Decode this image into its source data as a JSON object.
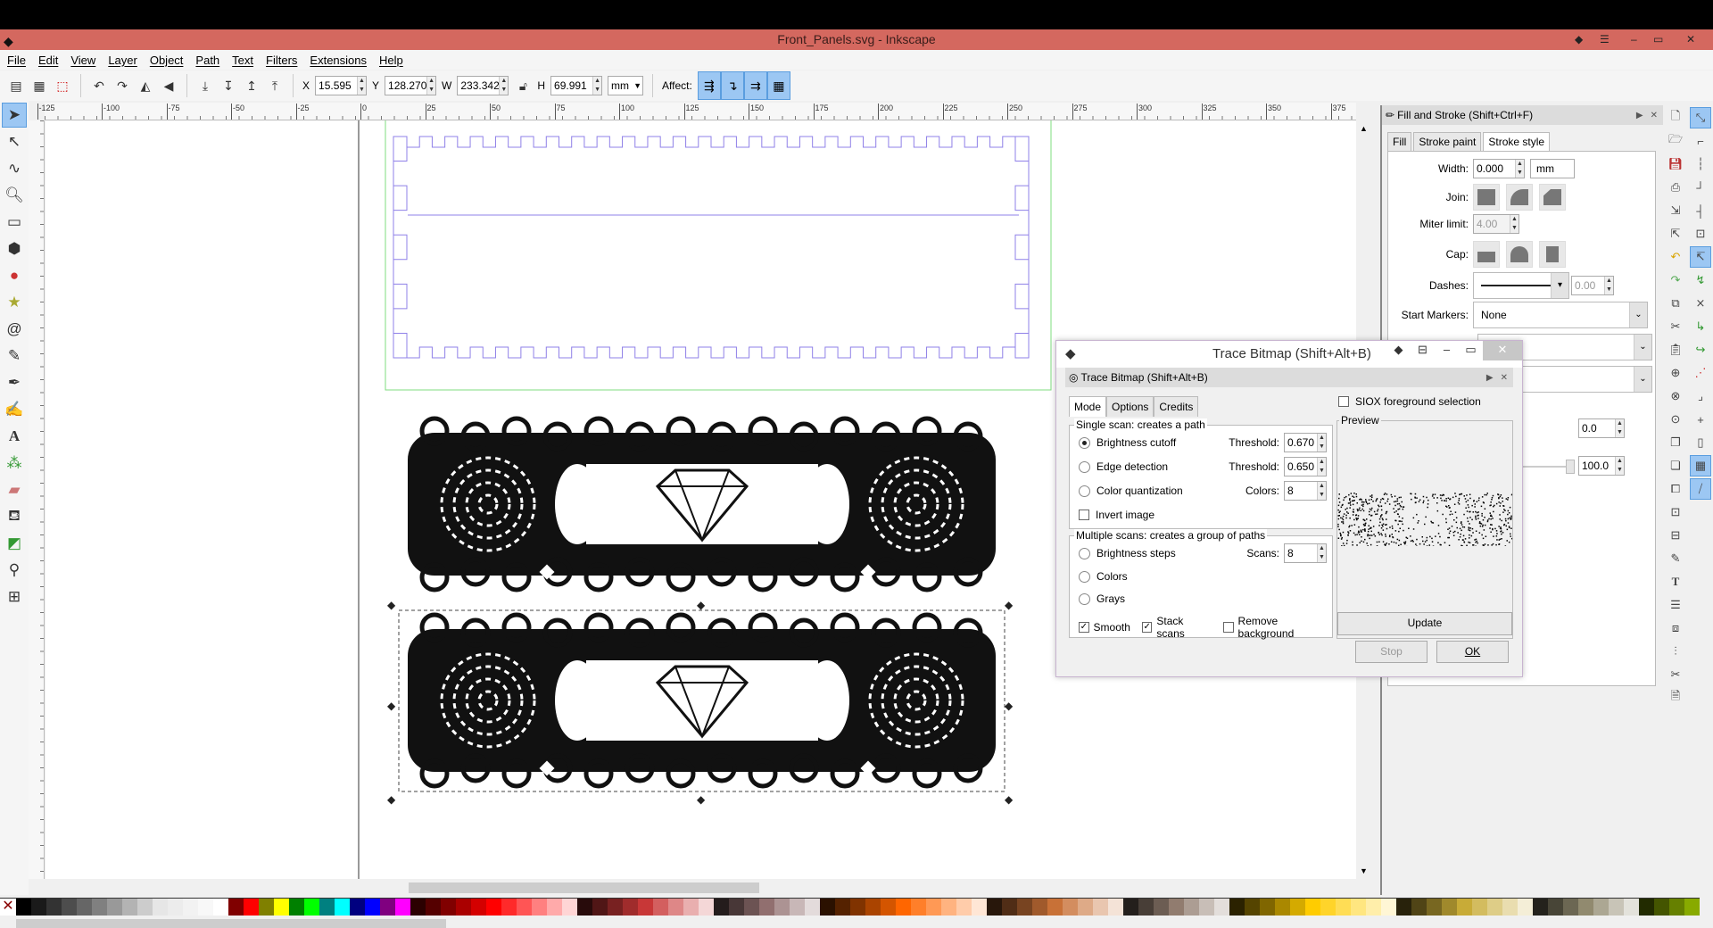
{
  "window": {
    "title": "Front_Panels.svg - Inkscape",
    "min": "–",
    "max": "▭",
    "close": "✕"
  },
  "menu": [
    "File",
    "Edit",
    "View",
    "Layer",
    "Object",
    "Path",
    "Text",
    "Filters",
    "Extensions",
    "Help"
  ],
  "toolbar": {
    "x_label": "X",
    "x": "15.595",
    "y_label": "Y",
    "y": "128.270",
    "w_label": "W",
    "w": "233.342",
    "h_label": "H",
    "h": "69.991",
    "unit": "mm",
    "affect_label": "Affect:"
  },
  "ruler_labels": [
    "-125",
    "-100",
    "-75",
    "-50",
    "-25",
    "0",
    "25",
    "50",
    "75",
    "100",
    "125",
    "150",
    "175",
    "200",
    "225",
    "250",
    "275",
    "300",
    "325",
    "350",
    "375"
  ],
  "tools": [
    "selector-tool",
    "node-tool",
    "tweak-tool",
    "zoom-tool",
    "rectangle-tool",
    "3d-box-tool",
    "ellipse-tool",
    "star-tool",
    "spiral-tool",
    "pencil-tool",
    "pen-tool",
    "calligraphy-tool",
    "text-tool",
    "spray-tool",
    "eraser-tool",
    "paint-bucket-tool",
    "gradient-tool",
    "dropper-tool",
    "connector-tool"
  ],
  "fill_stroke": {
    "title": "Fill and Stroke (Shift+Ctrl+F)",
    "tabs": [
      "Fill",
      "Stroke paint",
      "Stroke style"
    ],
    "width_label": "Width:",
    "width": "0.000",
    "unit": "mm",
    "join_label": "Join:",
    "miter_label": "Miter limit:",
    "miter": "4.00",
    "cap_label": "Cap:",
    "dashes_label": "Dashes:",
    "dash_offset": "0.00",
    "start_markers_label": "Start Markers:",
    "start_markers": "None",
    "blur": "0.0",
    "opacity": "100.0"
  },
  "trace": {
    "window_title": "Trace Bitmap (Shift+Alt+B)",
    "panel_title": "Trace Bitmap (Shift+Alt+B)",
    "tabs": [
      "Mode",
      "Options",
      "Credits"
    ],
    "single_scan_label": "Single scan: creates a path",
    "brightness_cutoff": "Brightness cutoff",
    "threshold_label": "Threshold:",
    "brightness_threshold": "0.670",
    "edge_detection": "Edge detection",
    "edge_threshold": "0.650",
    "color_quantization": "Color quantization",
    "colors_label": "Colors:",
    "colors": "8",
    "invert_image": "Invert image",
    "multiple_scans_label": "Multiple scans: creates a group of paths",
    "brightness_steps": "Brightness steps",
    "scans_label": "Scans:",
    "scans": "8",
    "colors_option": "Colors",
    "grays": "Grays",
    "smooth": "Smooth",
    "stack_scans": "Stack scans",
    "remove_background": "Remove background",
    "siox": "SIOX foreground selection",
    "preview_label": "Preview",
    "update": "Update",
    "stop": "Stop",
    "ok": "OK",
    "selected_mode": "Brightness cutoff",
    "smooth_checked": true,
    "stack_checked": true
  },
  "palette": [
    "#000000",
    "#1a1a1a",
    "#333333",
    "#4d4d4d",
    "#666666",
    "#808080",
    "#999999",
    "#b3b3b3",
    "#cccccc",
    "#e6e6e6",
    "#ececec",
    "#f2f2f2",
    "#f8f8f8",
    "#ffffff",
    "#800000",
    "#ff0000",
    "#808000",
    "#ffff00",
    "#008000",
    "#00ff00",
    "#008080",
    "#00ffff",
    "#000080",
    "#0000ff",
    "#800080",
    "#ff00ff",
    "#2b0000",
    "#550000",
    "#800000",
    "#aa0000",
    "#d40000",
    "#ff0000",
    "#ff2a2a",
    "#ff5555",
    "#ff8080",
    "#ffaaaa",
    "#ffd5d5",
    "#280b0b",
    "#501616",
    "#782121",
    "#a02c2c",
    "#c83737",
    "#d35f5f",
    "#de8787",
    "#e9afaf",
    "#f4d7d7",
    "#241c1c",
    "#483737",
    "#6c5353",
    "#916f6f",
    "#ac9393",
    "#c8b7b7",
    "#e3dbdb",
    "#2b1100",
    "#552200",
    "#803300",
    "#aa4400",
    "#d45500",
    "#ff6600",
    "#ff7f2a",
    "#ff9955",
    "#ffb380",
    "#ffccaa",
    "#ffe6d5",
    "#28170b",
    "#502d16",
    "#784421",
    "#a05a2c",
    "#c87137",
    "#d38d5f",
    "#deaa87",
    "#e9c6af",
    "#f4e3d7",
    "#241f1c",
    "#483e37",
    "#6c5d53",
    "#917c6f",
    "#ac9d93",
    "#c8beb7",
    "#e3dedb",
    "#2b2200",
    "#554400",
    "#806600",
    "#aa8800",
    "#d4aa00",
    "#ffcc00",
    "#ffd42a",
    "#ffdd55",
    "#ffe680",
    "#ffeeaa",
    "#fff6d5",
    "#28220b",
    "#504416",
    "#786721",
    "#a0892c",
    "#c8ab37",
    "#d3bc5f",
    "#decd87",
    "#e9ddaf",
    "#f4eed7",
    "#24221c",
    "#484537",
    "#6c6753",
    "#918a6f",
    "#aca793",
    "#c8c4b7",
    "#e3e2db",
    "#222b00",
    "#445500",
    "#668000",
    "#88aa00"
  ]
}
